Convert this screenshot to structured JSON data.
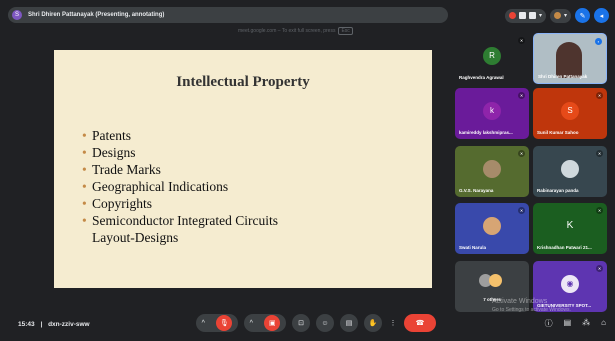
{
  "presenter_bar": {
    "avatar_letter": "S",
    "title": "Shri Dhiren Pattanayak (Presenting, annotating)"
  },
  "fullscreen_hint": {
    "text": "meet.google.com – To exit full screen, press",
    "key": "Esc"
  },
  "slide": {
    "title": "Intellectual Property",
    "bullets": [
      "Patents",
      "Designs",
      "Trade Marks",
      "Geographical Indications",
      "Copyrights",
      "Semiconductor Integrated Circuits"
    ],
    "continuation": "Layout-Designs"
  },
  "participants": [
    {
      "name": "Raghvendra Agrawal",
      "letter": "R",
      "color": "#2e7d32"
    },
    {
      "name": "Shri Dhiren Pattanayak",
      "letter": "",
      "color": "#b0bec5"
    },
    {
      "name": "kamireddy lakshmipras...",
      "letter": "k",
      "color": "#7b1fa2"
    },
    {
      "name": "Sunil Kumar Sahoo",
      "letter": "S",
      "color": "#d84315"
    },
    {
      "name": "G.V.S. Narayana",
      "letter": "",
      "color": "#6d7a5a"
    },
    {
      "name": "Rabinarayan panda",
      "letter": "",
      "color": "#5d6d7e"
    },
    {
      "name": "Swati Narula",
      "letter": "",
      "color": "#3f51b5"
    },
    {
      "name": "Krishnadhan Patwari 21...",
      "letter": "K",
      "color": "#1b5e20"
    },
    {
      "name": "7 others",
      "letter": "",
      "color": "#3c4043"
    },
    {
      "name": "GIETUNIVERSITY SPOT...",
      "letter": "",
      "color": "#5e35b1"
    }
  ],
  "meeting": {
    "time": "15:43",
    "separator": "|",
    "code": "dxn-zziv-sww"
  },
  "watermark": {
    "line1": "Activate Windows",
    "line2": "Go to Settings to activate Windows."
  },
  "colors": {
    "background": "#202124",
    "slide_bg": "#f5ecd0",
    "bullet": "#c48a47",
    "end_call": "#ea4335",
    "accent_blue": "#1a73e8"
  }
}
